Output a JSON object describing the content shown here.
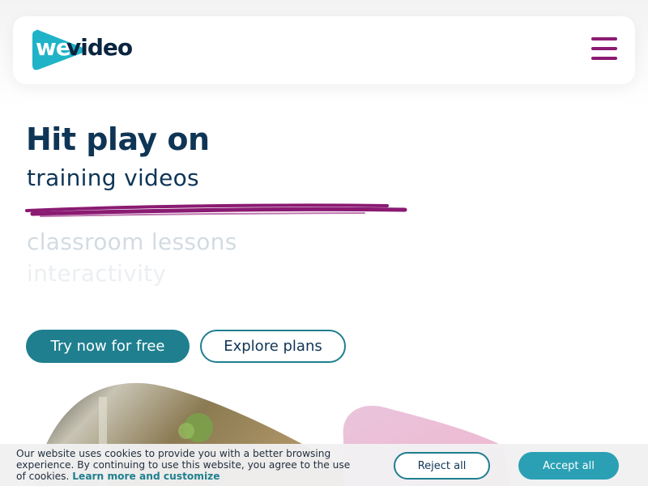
{
  "header": {
    "logo": {
      "we": "we",
      "video": "video"
    },
    "menu_icon": "hamburger-icon"
  },
  "hero": {
    "title": "Hit play on",
    "rotating_words": {
      "active": "training videos",
      "next": "classroom lessons",
      "after": "interactivity"
    },
    "buttons": {
      "primary": "Try now for free",
      "secondary": "Explore plans"
    }
  },
  "cookie_banner": {
    "text": "Our website uses cookies to provide you with a better browsing experience. By continuing to use this website, you agree to the use of cookies.",
    "link": "Learn more and customize",
    "reject": "Reject all",
    "accept": "Accept all"
  },
  "colors": {
    "brand_teal": "#1f7f8f",
    "logo_teal": "#1fb3c8",
    "accent_magenta": "#8a1a72",
    "navy": "#0f3556"
  }
}
